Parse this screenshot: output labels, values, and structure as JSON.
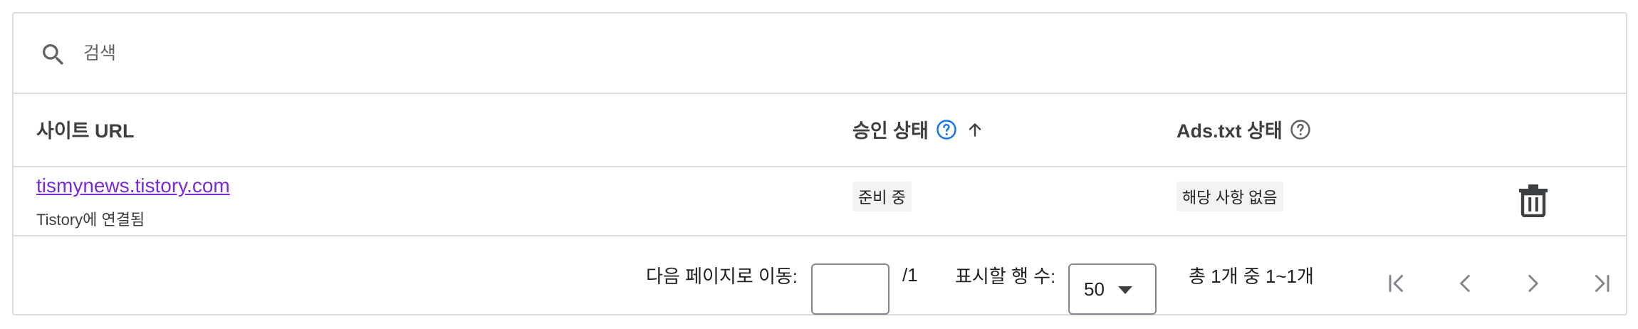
{
  "search": {
    "placeholder": "검색",
    "value": ""
  },
  "table": {
    "columns": [
      {
        "label": "사이트 URL",
        "help": false,
        "sort": "none"
      },
      {
        "label": "승인 상태",
        "help": true,
        "help_color": "#1a73e8",
        "sort": "ascending"
      },
      {
        "label": "Ads.txt 상태",
        "help": true,
        "help_color": "#5f6368",
        "sort": "none"
      }
    ],
    "rows": [
      {
        "site_url": "tismynews.tistory.com",
        "site_sub": "Tistory에 연결됨",
        "approval_status": "준비 중",
        "ads_txt_status": "해당 사항 없음"
      }
    ]
  },
  "pagination": {
    "goto_label": "다음 페이지로 이동:",
    "goto_value": "",
    "total_pages": "/1",
    "rows_label": "표시할 행 수:",
    "rows_value": "50",
    "range_text": "총 1개 중 1~1개"
  },
  "colors": {
    "link": "#7b2ad8",
    "help_accent": "#1a73e8",
    "border": "#dadce0",
    "chip_bg": "#f1f3f4"
  }
}
